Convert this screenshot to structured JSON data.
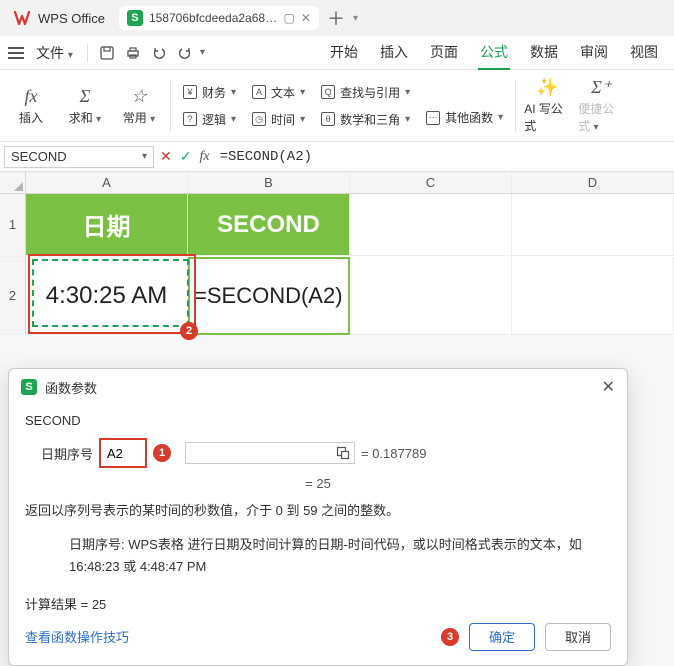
{
  "app": {
    "name": "WPS Office"
  },
  "doc_tab": {
    "badge": "S",
    "title": "158706bfcdeeda2a688df1e"
  },
  "menu": {
    "file": "文件",
    "tabs": [
      "开始",
      "插入",
      "页面",
      "公式",
      "数据",
      "审阅",
      "视图"
    ],
    "active_index": 3
  },
  "ribbon": {
    "insert_fn": "插入",
    "sum": "求和",
    "common": "常用",
    "finance": "财务",
    "logic": "逻辑",
    "text": "文本",
    "datetime": "时间",
    "lookup": "查找与引用",
    "math": "数学和三角",
    "other": "其他函数",
    "ai": "AI 写公式",
    "quick": "便捷公式"
  },
  "formula_bar": {
    "name": "SECOND",
    "formula": "=SECOND(A2)"
  },
  "grid": {
    "cols": [
      "A",
      "B",
      "C",
      "D"
    ],
    "r1": {
      "a": "日期",
      "b": "SECOND"
    },
    "r2": {
      "a": "4:30:25 AM",
      "b": "=SECOND(A2)"
    }
  },
  "badges": {
    "b2": "2",
    "b1": "1",
    "b3": "3"
  },
  "dialog": {
    "title": "函数参数",
    "fn": "SECOND",
    "arg_label": "日期序号",
    "arg_value": "A2",
    "arg_eval": "= 0.187789",
    "mid_eval": "= 25",
    "desc": "返回以序列号表示的某时间的秒数值，介于 0 到 59 之间的整数。",
    "desc_sub": "日期序号:  WPS表格 进行日期及时间计算的日期-时间代码，或以时间格式表示的文本，如 16:48:23 或 4:48:47 PM",
    "result": "计算结果 = 25",
    "link": "查看函数操作技巧",
    "ok": "确定",
    "cancel": "取消"
  }
}
